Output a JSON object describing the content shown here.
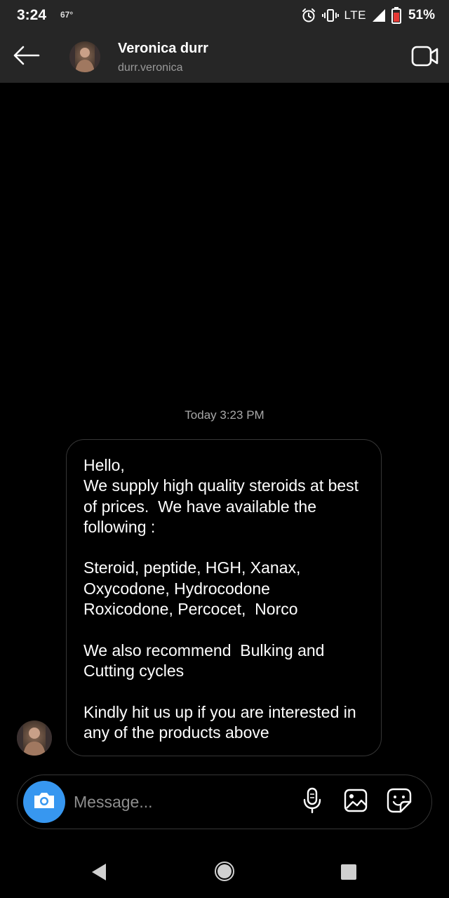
{
  "status_bar": {
    "time": "3:24",
    "temperature": "67°",
    "network": "LTE",
    "battery": "51%",
    "icons": [
      "alarm-icon",
      "vibrate-icon",
      "signal-icon",
      "battery-icon"
    ]
  },
  "header": {
    "name": "Veronica durr",
    "username": "durr.veronica",
    "icons": [
      "back-arrow-icon",
      "avatar",
      "video-call-icon"
    ]
  },
  "chat": {
    "timestamp": "Today 3:23 PM",
    "messages": [
      {
        "sender": "Veronica durr",
        "text": "Hello,\nWe supply high quality steroids at best of prices.  We have available the following :\n\nSteroid, peptide, HGH, Xanax, Oxycodone, Hydrocodone\nRoxicodone, Percocet,  Norco\n\nWe also recommend  Bulking and Cutting cycles\n\nKindly hit us up if you are interested in any of the products above"
      }
    ]
  },
  "composer": {
    "placeholder": "Message...",
    "value": "",
    "icons": [
      "camera-icon",
      "microphone-icon",
      "gallery-icon",
      "sticker-icon"
    ]
  },
  "nav_bar": {
    "icons": [
      "nav-back-icon",
      "nav-home-icon",
      "nav-recents-icon"
    ]
  },
  "colors": {
    "background": "#000000",
    "header_background": "#262626",
    "accent_blue": "#3797f0",
    "secondary_text": "#9a9a9a",
    "border": "#363636",
    "battery_low": "#e53935"
  }
}
